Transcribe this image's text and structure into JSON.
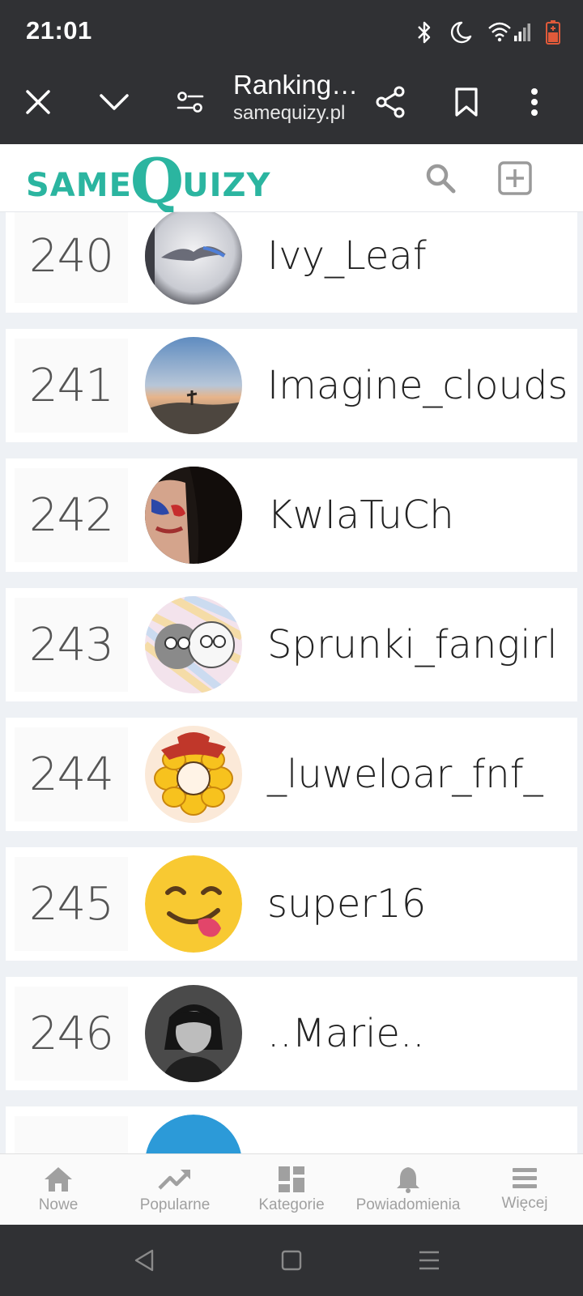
{
  "status_bar": {
    "time": "21:01",
    "icons": [
      "bluetooth-icon",
      "moon-icon",
      "wifi-icon",
      "signal-icon",
      "battery-icon"
    ]
  },
  "browser": {
    "page_title": "Ranking…",
    "domain": "samequizy.pl",
    "buttons": [
      "close-icon",
      "chevron-down-icon",
      "site-settings-icon",
      "share-icon",
      "bookmark-icon",
      "more-icon"
    ]
  },
  "site": {
    "logo_same": "SAME",
    "logo_q": "Q",
    "logo_uizy": "UIZY",
    "brand_color": "#2bb5a0"
  },
  "ranking": [
    {
      "rank": "240",
      "name": "Ivy_Leaf"
    },
    {
      "rank": "241",
      "name": "Imagine_clouds"
    },
    {
      "rank": "242",
      "name": "KwIaTuCh"
    },
    {
      "rank": "243",
      "name": "Sprunki_fangirl"
    },
    {
      "rank": "244",
      "name": "_luweloar_fnf_"
    },
    {
      "rank": "245",
      "name": "super16"
    },
    {
      "rank": "246",
      "name": "..Marie.."
    }
  ],
  "bottom_nav": {
    "items": [
      {
        "label": "Nowe",
        "icon": "home-icon"
      },
      {
        "label": "Popularne",
        "icon": "trending-icon"
      },
      {
        "label": "Kategorie",
        "icon": "grid-icon"
      },
      {
        "label": "Powiadomienia",
        "icon": "bell-icon"
      },
      {
        "label": "Więcej",
        "icon": "menu-icon"
      }
    ]
  }
}
